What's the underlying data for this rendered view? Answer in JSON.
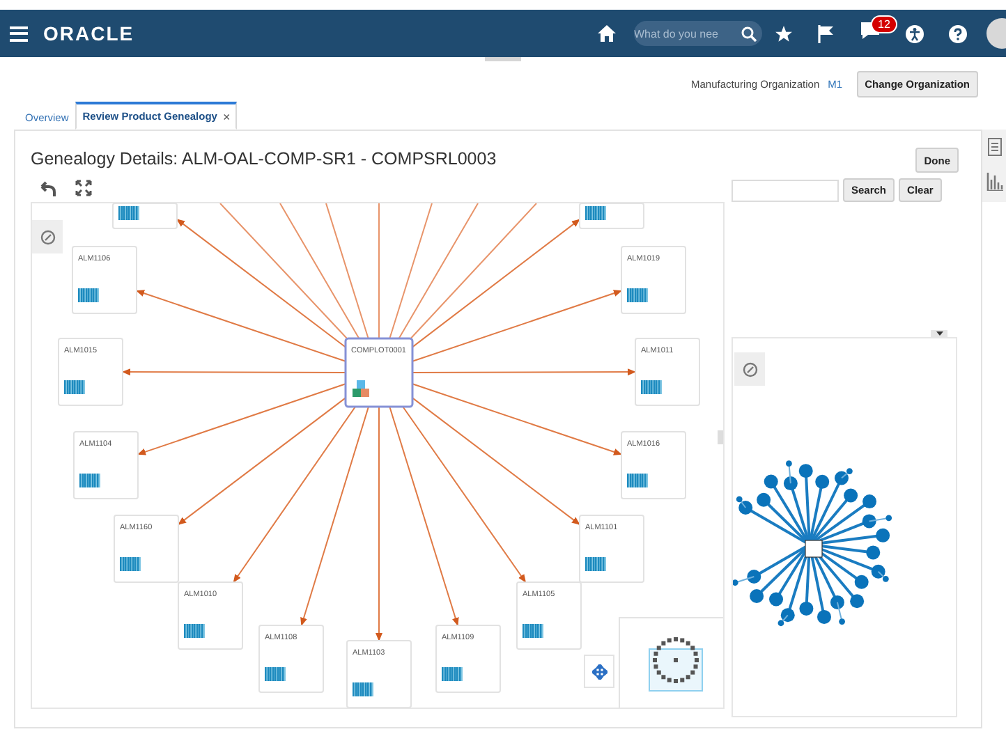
{
  "header": {
    "logo": "ORACLE",
    "search": {
      "placeholder": "What do you nee"
    },
    "notification_count": "12"
  },
  "organization": {
    "label": "Manufacturing Organization",
    "value": "M1",
    "button": "Change Organization"
  },
  "tabs": [
    {
      "label": "Overview",
      "selected": false,
      "closable": false
    },
    {
      "label": "Review Product Genealogy",
      "selected": true,
      "closable": true,
      "close": "×"
    }
  ],
  "page": {
    "title": "Genealogy Details: ALM-OAL-COMP-SR1 - COMPSRL0003",
    "done_button": "Done",
    "search_button": "Search",
    "clear_button": "Clear"
  },
  "diagram": {
    "root": {
      "label": "COMPLOT0001"
    },
    "children": [
      {
        "kind": "clipped"
      },
      {
        "kind": "clipped"
      },
      {
        "kind": "node",
        "label": "ALM1106"
      },
      {
        "kind": "node",
        "label": "ALM1019"
      },
      {
        "kind": "node",
        "label": "ALM1015"
      },
      {
        "kind": "node",
        "label": "ALM1011"
      },
      {
        "kind": "node",
        "label": "ALM1104"
      },
      {
        "kind": "node",
        "label": "ALM1016"
      },
      {
        "kind": "node",
        "label": "ALM1160"
      },
      {
        "kind": "node",
        "label": "ALM1101"
      },
      {
        "kind": "node",
        "label": "ALM1010"
      },
      {
        "kind": "node",
        "label": "ALM1105"
      },
      {
        "kind": "node",
        "label": "ALM1108"
      },
      {
        "kind": "node",
        "label": "ALM1103"
      },
      {
        "kind": "node",
        "label": "ALM1109"
      }
    ]
  }
}
